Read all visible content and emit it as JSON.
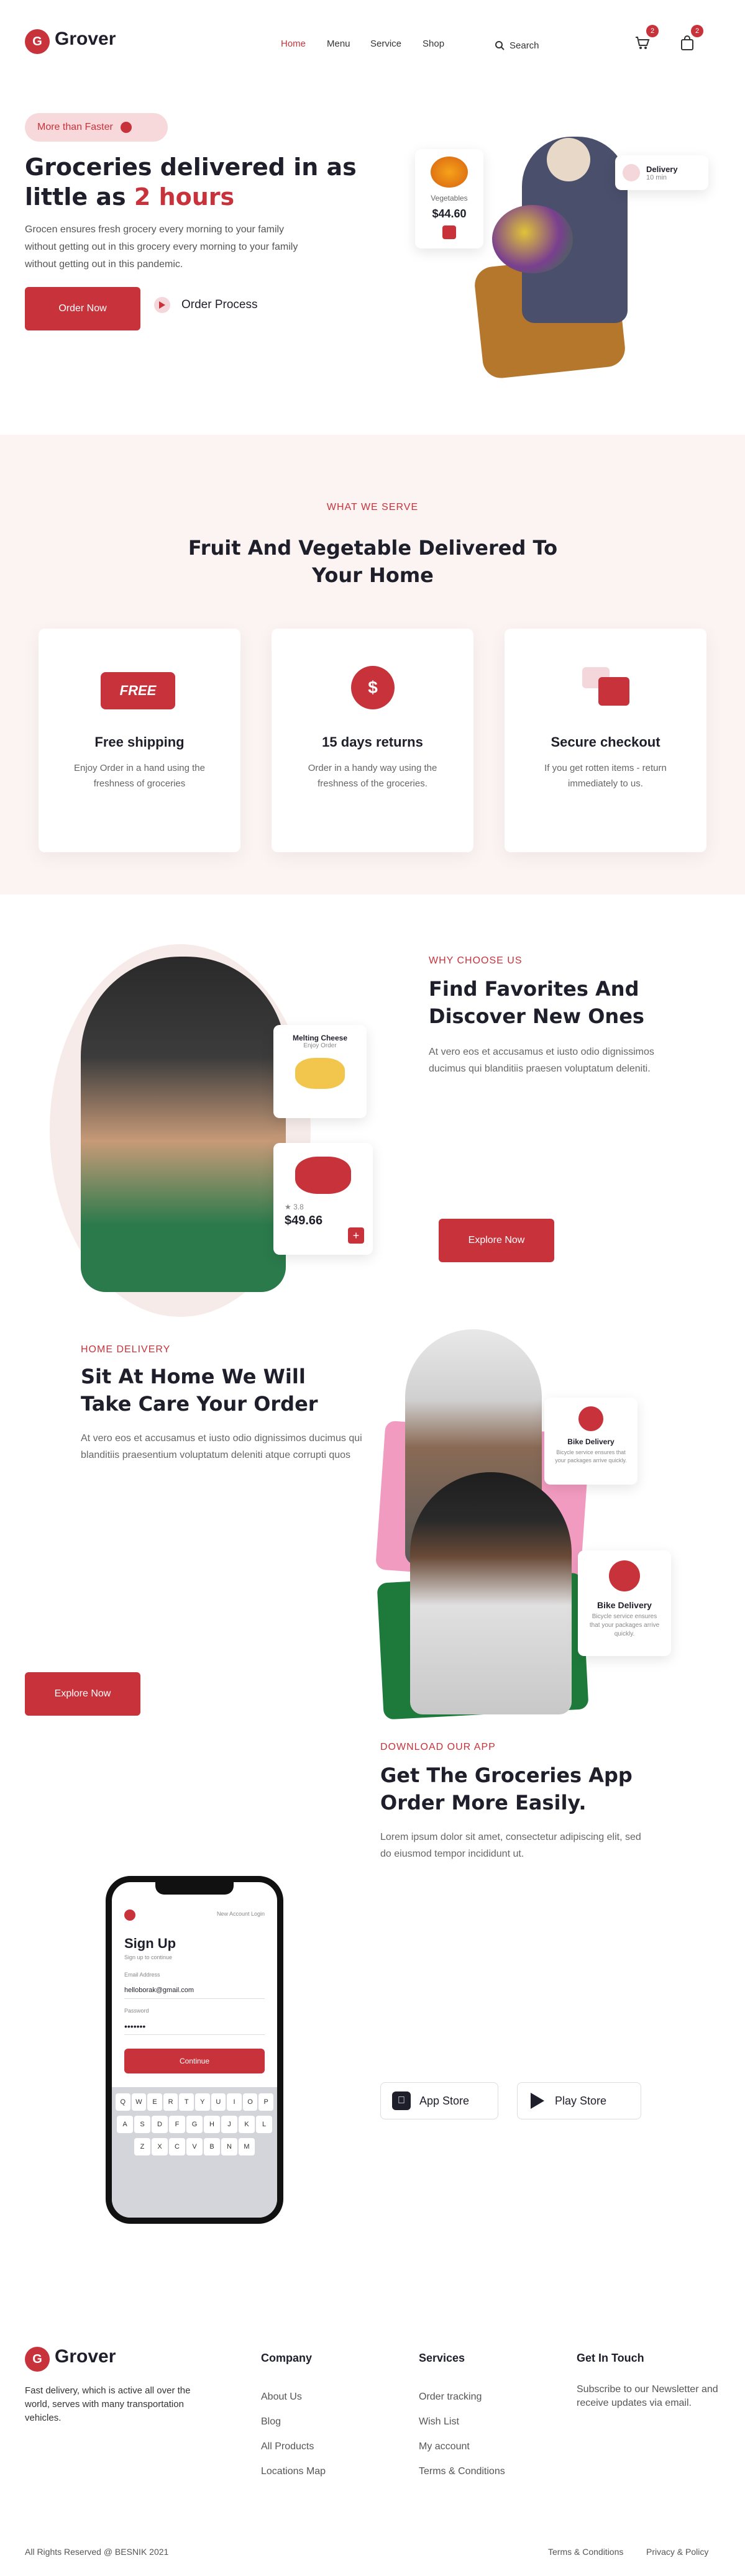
{
  "nav": {
    "logo_letter": "G",
    "brand": "Grover",
    "links": [
      {
        "label": "Home"
      },
      {
        "label": "Menu"
      },
      {
        "label": "Service"
      },
      {
        "label": "Shop"
      }
    ],
    "search_placeholder": "Search",
    "cart_count": "2",
    "bag_count": "2"
  },
  "hero": {
    "pill": "More than Faster",
    "title_line1": "Groceries delivered in as",
    "title_line2_prefix": "little as ",
    "title_line2_accent": "2 hours",
    "subtitle": "Grocen ensures fresh grocery every morning to your family without getting out in this grocery every morning to your family without getting out in this pandemic.",
    "cta": "Order Now",
    "secondary": "Order Process",
    "delivery_badge": {
      "title": "Delivery",
      "subtitle": "10 min"
    },
    "product_card": {
      "name": "Vegetables",
      "price": "$44.60"
    }
  },
  "services": {
    "label": "What we Serve",
    "title": "Fruit And Vegetable Delivered To Your Home",
    "items": [
      {
        "badge": "FREE",
        "title": "Free shipping",
        "text": "Enjoy Order in a hand using the freshness of groceries"
      },
      {
        "badge": "$",
        "title": "15 days returns",
        "text": "Order in a handy way using the freshness of the groceries."
      },
      {
        "badge": "",
        "title": "Secure checkout",
        "text": "If you get rotten items - return immediately to us."
      }
    ]
  },
  "choose": {
    "label": "Why Choose Us",
    "title": "Find Favorites And Discover New Ones",
    "text": "At vero eos et accusamus et iusto odio dignissimos ducimus qui blanditiis praesen voluptatum deleniti.",
    "cta": "Explore Now",
    "card1": {
      "name": "Melting Cheese",
      "sub": "Enjoy Order"
    },
    "card2": {
      "rating": "3.8",
      "price": "$49.66"
    }
  },
  "delivery": {
    "label": "Home Delivery",
    "title": "Sit At Home We Will Take Care Your Order",
    "text": "At vero eos et accusamus et iusto odio dignissimos ducimus qui blanditiis praesentium voluptatum deleniti atque corrupti quos",
    "cta": "Explore Now",
    "badge1": {
      "title": "Bike Delivery",
      "text": "Bicycle service ensures that your packages arrive quickly."
    },
    "badge2": {
      "title": "Bike Delivery",
      "text": "Bicycle service ensures that your packages arrive quickly."
    }
  },
  "app": {
    "label": "Download our app",
    "title": "Get The Groceries App Order More Easily.",
    "text": "Lorem ipsum dolor sit amet, consectetur adipiscing elit, sed do eiusmod tempor incididunt ut.",
    "app_store": "App Store",
    "play_store": "Play Store",
    "phone": {
      "top_link": "New Account Login",
      "heading": "Sign Up",
      "sub": "Sign up to continue",
      "email_label": "Email Address",
      "email_value": "helloborak@gmail.com",
      "password_label": "Password",
      "password_value": "•••••••",
      "button": "Continue",
      "keys_row1": [
        "Q",
        "W",
        "E",
        "R",
        "T",
        "Y",
        "U",
        "I",
        "O",
        "P"
      ],
      "keys_row2": [
        "A",
        "S",
        "D",
        "F",
        "G",
        "H",
        "J",
        "K",
        "L"
      ],
      "keys_row3": [
        "Z",
        "X",
        "C",
        "V",
        "B",
        "N",
        "M"
      ]
    }
  },
  "footer": {
    "brand": "Grover",
    "logo_letter": "G",
    "tagline": "Fast delivery, which is active all over the world, serves with many transportation vehicles.",
    "columns": [
      {
        "title": "Company",
        "links": [
          "About Us",
          "Blog",
          "All Products",
          "Locations Map"
        ]
      },
      {
        "title": "Services",
        "links": [
          "Order tracking",
          "Wish List",
          "My account",
          "Terms & Conditions"
        ]
      }
    ],
    "contact_title": "Get In Touch",
    "contact_text": "Subscribe to our Newsletter and receive updates via email.",
    "copyright": "All Rights Reserved @ BESNIK 2021",
    "bottom_links": [
      "Terms & Conditions",
      "Privacy & Policy"
    ]
  },
  "colors": {
    "accent": "#c8323b",
    "dark": "#1f1f2b",
    "green": "#1e7a3a",
    "pink": "#f29bc1"
  }
}
